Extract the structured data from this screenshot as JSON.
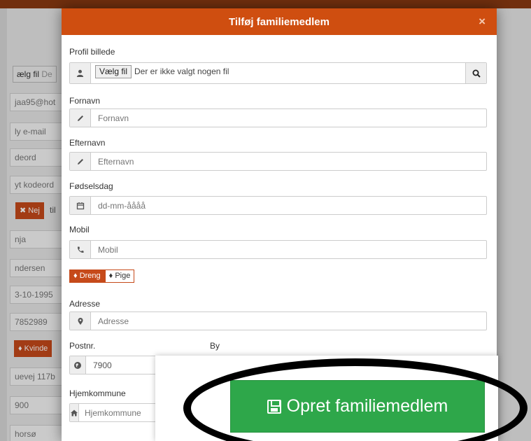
{
  "background": {
    "rows": [
      "jaa95@hot",
      "ly e-mail",
      "deord",
      "yt kodeord",
      "nja",
      "ndersen",
      "3-10-1995",
      "7852989",
      "uevej 117b",
      "900",
      "horsø"
    ],
    "file_button": "ælg fil",
    "file_text": "De",
    "no_label": "✖ Nej",
    "no_suffix": "til",
    "female_label": "♦ Kvinde"
  },
  "modal": {
    "title": "Tilføj familiemedlem",
    "close": "×",
    "profile": {
      "label": "Profil billede",
      "file_button": "Vælg fil",
      "file_status": "Der er ikke valgt nogen fil"
    },
    "first_name": {
      "label": "Fornavn",
      "placeholder": "Fornavn"
    },
    "last_name": {
      "label": "Efternavn",
      "placeholder": "Efternavn"
    },
    "birthday": {
      "label": "Fødselsdag",
      "placeholder": "dd-mm-åååå"
    },
    "mobile": {
      "label": "Mobil",
      "placeholder": "Mobil"
    },
    "gender": {
      "boy": "Dreng",
      "girl": "Pige",
      "selected": "Dreng"
    },
    "address": {
      "label": "Adresse",
      "placeholder": "Adresse"
    },
    "postal": {
      "label": "Postnr.",
      "value": "7900"
    },
    "city": {
      "label": "By"
    },
    "municipality": {
      "label": "Hjemkommune",
      "placeholder": "Hjemkommune"
    }
  },
  "create_button": {
    "label": "Opret familiemedlem"
  },
  "colors": {
    "header": "#cf4e10",
    "accent": "#c64a1a",
    "create": "#2ea74a"
  },
  "icons": [
    "user-icon",
    "search-icon",
    "pencil-icon",
    "calendar-icon",
    "phone-icon",
    "male-icon",
    "female-icon",
    "map-marker-icon",
    "globe-icon",
    "home-icon",
    "save-icon"
  ]
}
